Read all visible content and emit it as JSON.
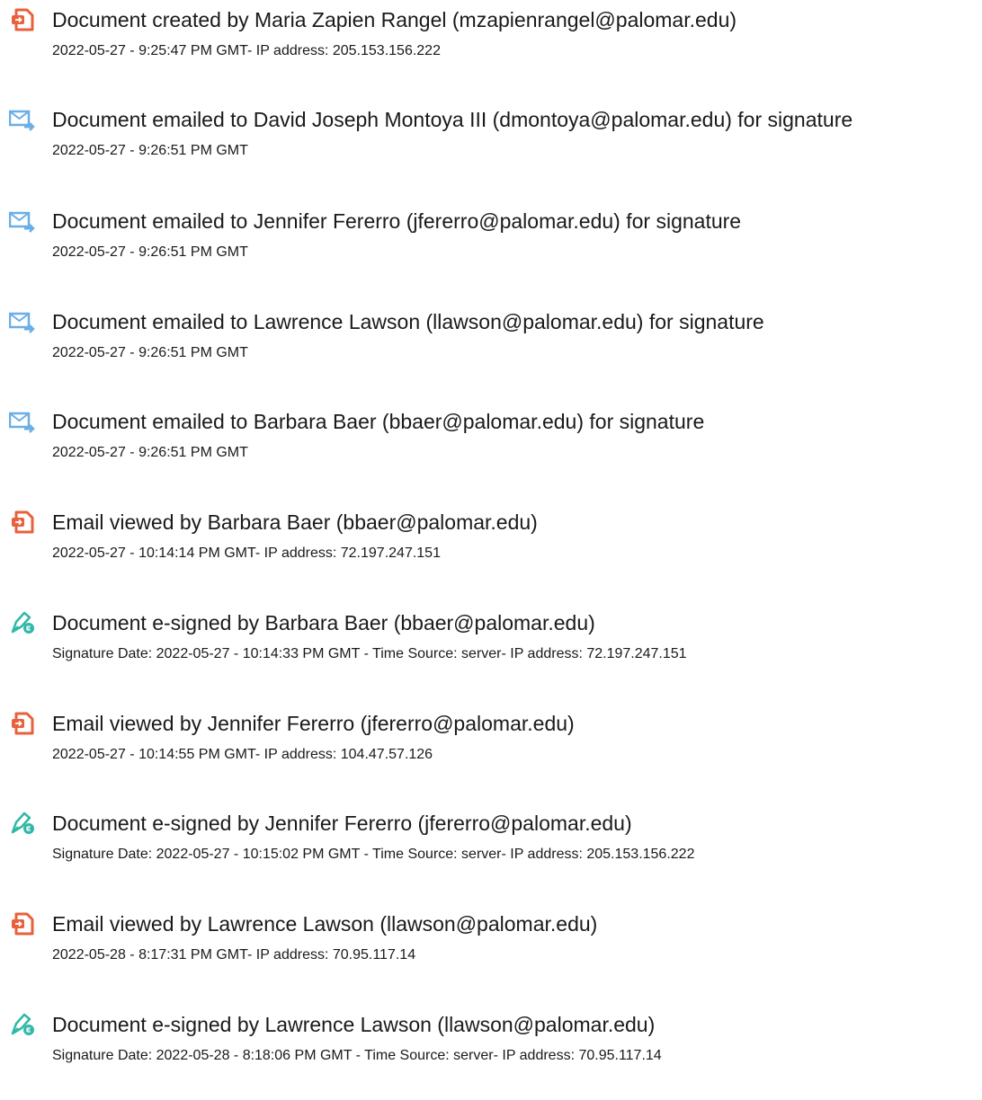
{
  "colors": {
    "created_icon": "#e8603c",
    "emailed_icon": "#6aaee6",
    "viewed_icon": "#e8603c",
    "signed_icon": "#2fb8a8"
  },
  "events": [
    {
      "icon": "document-created-icon",
      "title": "Document created by Maria Zapien Rangel (mzapienrangel@palomar.edu)",
      "detail": "2022-05-27 - 9:25:47 PM GMT- IP address: 205.153.156.222"
    },
    {
      "icon": "document-emailed-icon",
      "title": "Document emailed to David Joseph Montoya III (dmontoya@palomar.edu) for signature",
      "detail": "2022-05-27 - 9:26:51 PM GMT"
    },
    {
      "icon": "document-emailed-icon",
      "title": "Document emailed to Jennifer Fererro (jfererro@palomar.edu) for signature",
      "detail": "2022-05-27 - 9:26:51 PM GMT"
    },
    {
      "icon": "document-emailed-icon",
      "title": "Document emailed to Lawrence Lawson (llawson@palomar.edu) for signature",
      "detail": "2022-05-27 - 9:26:51 PM GMT"
    },
    {
      "icon": "document-emailed-icon",
      "title": "Document emailed to Barbara Baer (bbaer@palomar.edu) for signature",
      "detail": "2022-05-27 - 9:26:51 PM GMT"
    },
    {
      "icon": "email-viewed-icon",
      "title": "Email viewed by Barbara Baer (bbaer@palomar.edu)",
      "detail": "2022-05-27 - 10:14:14 PM GMT- IP address: 72.197.247.151"
    },
    {
      "icon": "document-esigned-icon",
      "title": "Document e-signed by Barbara Baer (bbaer@palomar.edu)",
      "detail": "Signature Date: 2022-05-27 - 10:14:33 PM GMT - Time Source: server- IP address: 72.197.247.151"
    },
    {
      "icon": "email-viewed-icon",
      "title": "Email viewed by Jennifer Fererro (jfererro@palomar.edu)",
      "detail": "2022-05-27 - 10:14:55 PM GMT- IP address: 104.47.57.126"
    },
    {
      "icon": "document-esigned-icon",
      "title": "Document e-signed by Jennifer Fererro (jfererro@palomar.edu)",
      "detail": "Signature Date: 2022-05-27 - 10:15:02 PM GMT - Time Source: server- IP address: 205.153.156.222"
    },
    {
      "icon": "email-viewed-icon",
      "title": "Email viewed by Lawrence Lawson (llawson@palomar.edu)",
      "detail": "2022-05-28 - 8:17:31 PM GMT- IP address: 70.95.117.14"
    },
    {
      "icon": "document-esigned-icon",
      "title": "Document e-signed by Lawrence Lawson (llawson@palomar.edu)",
      "detail": "Signature Date: 2022-05-28 - 8:18:06 PM GMT - Time Source: server- IP address: 70.95.117.14"
    }
  ]
}
